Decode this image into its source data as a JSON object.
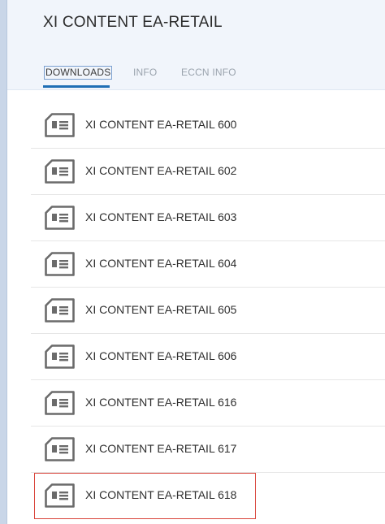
{
  "header": {
    "title": "XI CONTENT EA-RETAIL"
  },
  "tabs": [
    {
      "label": "DOWNLOADS"
    },
    {
      "label": "INFO"
    },
    {
      "label": "ECCN INFO"
    }
  ],
  "downloads": [
    {
      "label": "XI CONTENT EA-RETAIL 600",
      "icon": "document-icon"
    },
    {
      "label": "XI CONTENT EA-RETAIL 602",
      "icon": "document-icon"
    },
    {
      "label": "XI CONTENT EA-RETAIL 603",
      "icon": "document-icon"
    },
    {
      "label": "XI CONTENT EA-RETAIL 604",
      "icon": "document-icon"
    },
    {
      "label": "XI CONTENT EA-RETAIL 605",
      "icon": "document-icon"
    },
    {
      "label": "XI CONTENT EA-RETAIL 606",
      "icon": "document-icon"
    },
    {
      "label": "XI CONTENT EA-RETAIL 616",
      "icon": "document-icon"
    },
    {
      "label": "XI CONTENT EA-RETAIL 617",
      "icon": "document-icon"
    },
    {
      "label": "XI CONTENT EA-RETAIL 618",
      "icon": "document-icon"
    }
  ],
  "colors": {
    "accent": "#1f6fb5",
    "highlight_border": "#d9443a",
    "header_bg": "#f1f5fb",
    "icon": "#6b6b6b"
  }
}
